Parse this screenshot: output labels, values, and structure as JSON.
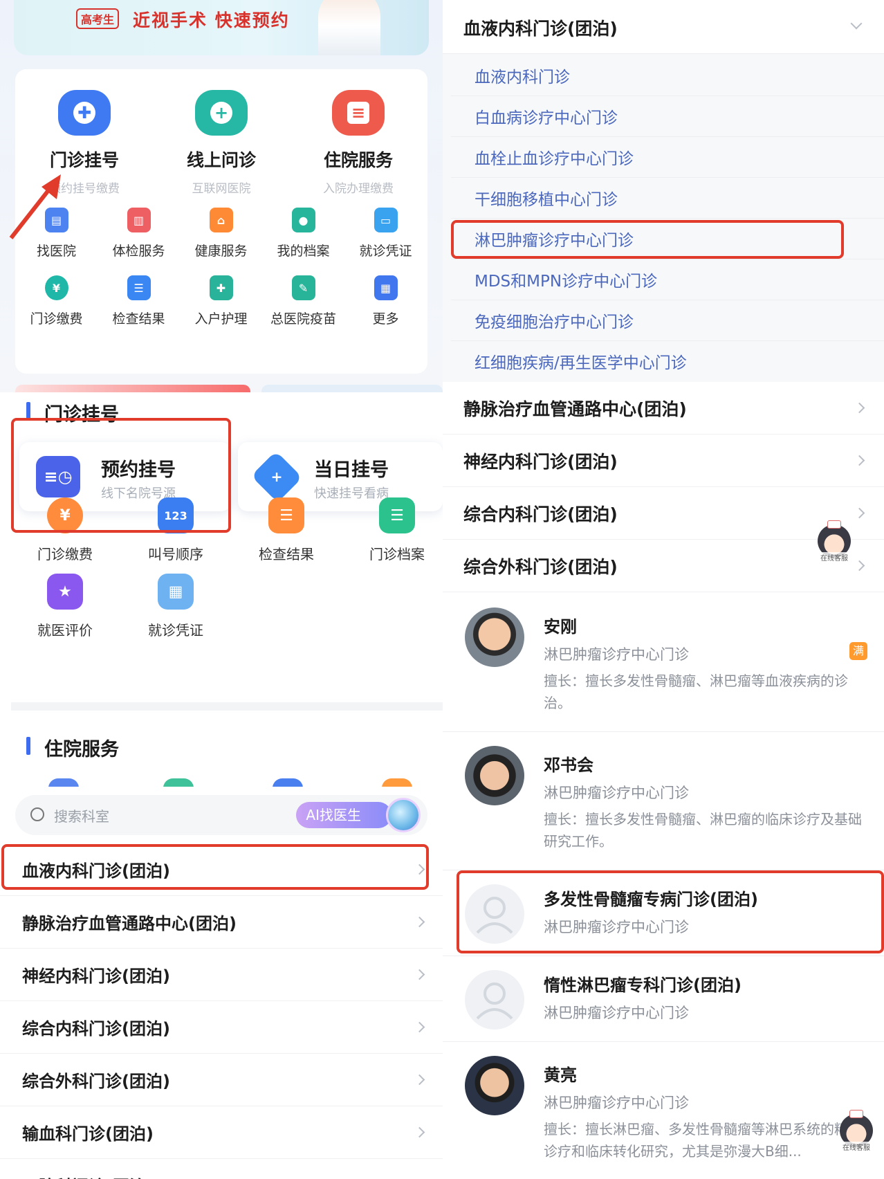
{
  "home": {
    "banner": {
      "tag": "高考生",
      "slogan": "近视手术  快速预约"
    },
    "main_services": [
      {
        "label": "门诊挂号",
        "sub": "预约挂号缴费",
        "color": "#3f7af2",
        "icon": "plus-icon"
      },
      {
        "label": "线上问诊",
        "sub": "互联网医院",
        "color": "#26b8a5",
        "icon": "chat-plus-icon"
      },
      {
        "label": "住院服务",
        "sub": "入院办理缴费",
        "color": "#ee5a4b",
        "icon": "document-icon"
      }
    ],
    "grid_row1": [
      {
        "label": "找医院",
        "color": "#4c83f0",
        "icon": "building-icon"
      },
      {
        "label": "体检服务",
        "color": "#ee5f63",
        "icon": "report-icon"
      },
      {
        "label": "健康服务",
        "color": "#ff8a36",
        "icon": "shop-icon"
      },
      {
        "label": "我的档案",
        "color": "#27b59b",
        "icon": "profile-icon"
      },
      {
        "label": "就诊凭证",
        "color": "#3aa3f0",
        "icon": "card-icon"
      }
    ],
    "grid_row2": [
      {
        "label": "门诊缴费",
        "color": "#1fb8a8",
        "icon": "yuan-icon"
      },
      {
        "label": "检查结果",
        "color": "#3a86f2",
        "icon": "list-icon"
      },
      {
        "label": "入户护理",
        "color": "#29b39a",
        "icon": "nurse-icon"
      },
      {
        "label": "总医院疫苗",
        "color": "#28b499",
        "icon": "vaccine-icon"
      },
      {
        "label": "更多",
        "color": "#4077ee",
        "icon": "grid-icon"
      }
    ]
  },
  "outpatient": {
    "title": "门诊挂号",
    "appointment": {
      "title": "预约挂号",
      "sub": "线下名院号源",
      "color": "#4b63e8"
    },
    "same_day": {
      "title": "当日挂号",
      "sub": "快速挂号看病",
      "color": "#3c8af4"
    },
    "grid": [
      {
        "label": "门诊缴费",
        "color": "#ff8b3d",
        "icon": "yuan-icon"
      },
      {
        "label": "叫号顺序",
        "color": "#3a7ef2",
        "icon": "queue-number-icon"
      },
      {
        "label": "检查结果",
        "color": "#ff8c3a",
        "icon": "list-icon"
      },
      {
        "label": "门诊档案",
        "color": "#2cc28e",
        "icon": "archive-icon"
      },
      {
        "label": "就医评价",
        "color": "#8a58ef",
        "icon": "star-icon"
      },
      {
        "label": "就诊凭证",
        "color": "#6fb2f2",
        "icon": "card-icon"
      }
    ],
    "inpatient_title": "住院服务"
  },
  "departments": {
    "search_placeholder": "搜索科室",
    "ai_label": "AI找医生",
    "list": [
      "血液内科门诊(团泊)",
      "静脉治疗血管通路中心(团泊)",
      "神经内科门诊(团泊)",
      "综合内科门诊(团泊)",
      "综合外科门诊(团泊)",
      "输血科门诊(团泊)",
      "口腔科门诊(团泊)"
    ]
  },
  "right": {
    "header": "血液内科门诊(团泊)",
    "sub_departments": [
      "血液内科门诊",
      "白血病诊疗中心门诊",
      "血栓止血诊疗中心门诊",
      "干细胞移植中心门诊",
      "淋巴肿瘤诊疗中心门诊",
      "MDS和MPN诊疗中心门诊",
      "免疫细胞治疗中心门诊",
      "红细胞疾病/再生医学中心门诊"
    ],
    "other_departments": [
      "静脉治疗血管通路中心(团泊)",
      "神经内科门诊(团泊)",
      "综合内科门诊(团泊)",
      "综合外科门诊(团泊)"
    ],
    "customer_service": "在线客服",
    "doctors": [
      {
        "name": "安刚",
        "dept": "淋巴肿瘤诊疗中心门诊",
        "specialty": "擅长：擅长多发性骨髓瘤、淋巴瘤等血液疾病的诊治。",
        "badge": "满"
      },
      {
        "name": "邓书会",
        "dept": "淋巴肿瘤诊疗中心门诊",
        "specialty": "擅长：擅长多发性骨髓瘤、淋巴瘤的临床诊疗及基础研究工作。"
      },
      {
        "name": "多发性骨髓瘤专病门诊(团泊)",
        "dept": "淋巴肿瘤诊疗中心门诊"
      },
      {
        "name": "惰性淋巴瘤专科门诊(团泊)",
        "dept": "淋巴肿瘤诊疗中心门诊"
      },
      {
        "name": "黄亮",
        "dept": "淋巴肿瘤诊疗中心门诊",
        "specialty": "擅长：擅长淋巴瘤、多发性骨髓瘤等淋巴系统的精准诊疗和临床转化研究，尤其是弥漫大B细..."
      }
    ]
  },
  "colors": {
    "highlight": "#e03b2b",
    "accent": "#3d6cf0"
  }
}
